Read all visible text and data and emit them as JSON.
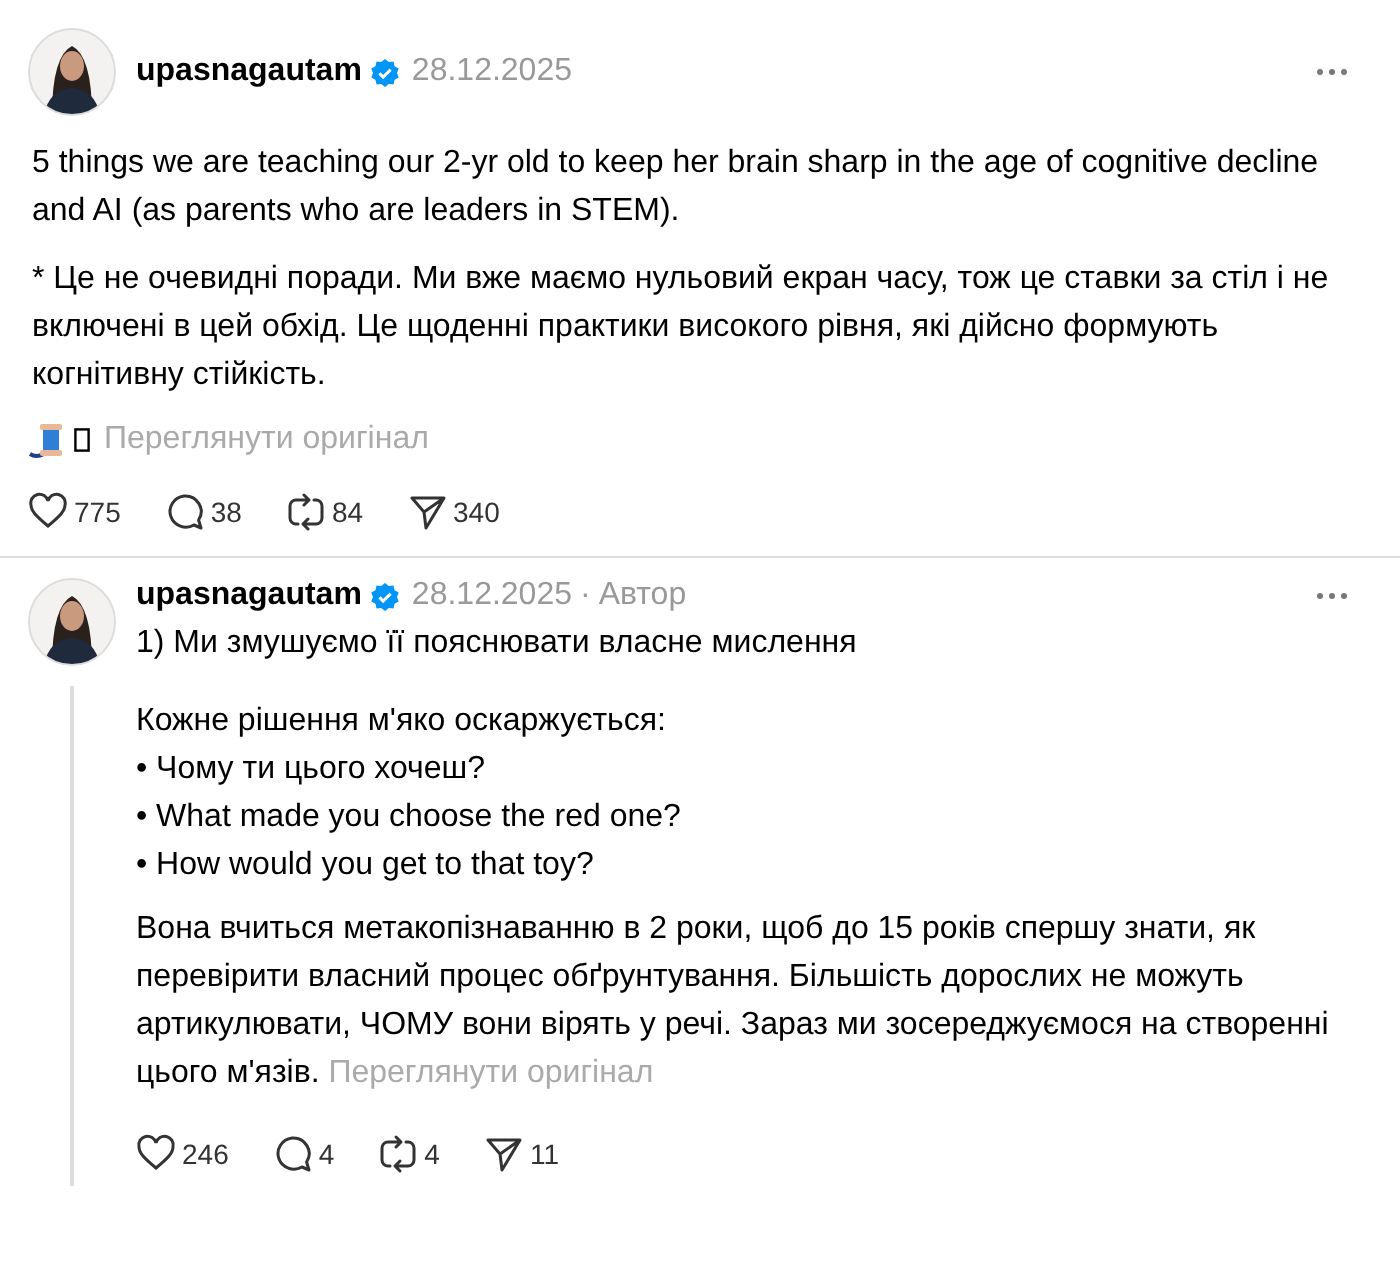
{
  "posts": [
    {
      "kind": "root",
      "username": "upasnagautam",
      "verified": true,
      "date": "28.12.2025",
      "paragraphs": [
        "5 things we are teaching our 2-yr old to keep her brain sharp in the age of cognitive decline and AI (as parents who are leaders in STEM).",
        "* Це не очевидні поради. Ми вже маємо нульовий екран часу, тож це ставки за стіл і не включені в цей обхід. Це щоденні практики високого рівня, які дійсно формують когнітивну стійкість."
      ],
      "translate_link": "Переглянути оригінал",
      "stats": {
        "likes": "775",
        "replies": "38",
        "reposts": "84",
        "shares": "340"
      }
    },
    {
      "kind": "reply",
      "username": "upasnagautam",
      "verified": true,
      "date": "28.12.2025",
      "separator": "·",
      "author_label": "Автор",
      "heading": "1) Ми змушуємо її пояснювати власне мислення",
      "paragraphs": [
        "Кожне рішення м'яко оскаржується:\n• Чому ти цього хочеш?\n• What made you choose the red one?\n• How would you get to that toy?",
        "Вона вчиться метакопізнаванню в 2 роки, щоб до 15 років спершу знати, як перевірити власний процес обґрунтування. Більшість дорослих не можуть артикулювати, ЧОМУ вони вірять у речі. Зараз ми зосереджуємося на створенні цього м'язів."
      ],
      "translate_link": "Переглянути оригінал",
      "stats": {
        "likes": "246",
        "replies": "4",
        "reposts": "4",
        "shares": "11"
      }
    }
  ]
}
